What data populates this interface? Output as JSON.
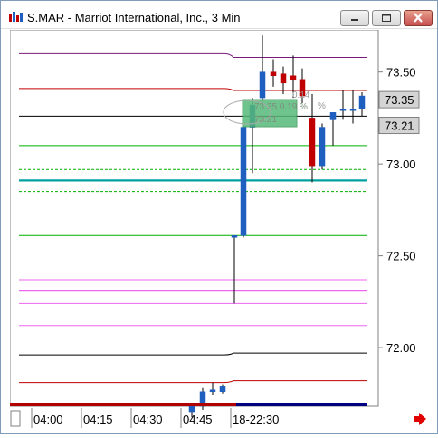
{
  "window": {
    "title": "S.MAR - Marriot International, Inc., 3 Min",
    "buttons": [
      "minimize",
      "maximize",
      "close"
    ]
  },
  "colors": {
    "up_candle": "#1f5fbf",
    "down_candle": "#c00000",
    "purple_line": "#7a1a7a",
    "red_line": "#c00000",
    "black_line": "#000000",
    "green_line": "#00b000",
    "teal_line": "#00a0a0",
    "pink_line": "#ee66ee",
    "bottom_bar_red": "#b00000",
    "bottom_bar_blue": "#000080",
    "price_tag_bg": "#d4d4d4",
    "highlight_box": "#56b97a"
  },
  "chart_data": {
    "type": "candlestick",
    "y_ticks": [
      "73.50",
      "73.00",
      "72.50",
      "72.00"
    ],
    "ylim": [
      71.68,
      73.73
    ],
    "x_ticks": [
      "04:00",
      "04:15",
      "04:30",
      "04:45",
      "18-22:30"
    ],
    "price_tags": [
      {
        "label": "73.35",
        "value": 73.35
      },
      {
        "label": "73.21",
        "value": 73.21
      }
    ],
    "overlay_text": {
      "box_line1": "73.35 0.19 %",
      "box_line2": "73.21",
      "pct_label": "0.14",
      "pct_line2": "%"
    },
    "horizontal_levels": [
      {
        "value": 73.6,
        "value_after": 73.58,
        "color_key": "purple_line",
        "style": "solid"
      },
      {
        "value": 73.41,
        "value_after": 73.4,
        "color_key": "red_line",
        "style": "solid"
      },
      {
        "value": 73.26,
        "value_after": 73.26,
        "color_key": "black_line",
        "style": "solid"
      },
      {
        "value": 73.1,
        "value_after": 73.1,
        "color_key": "green_line",
        "style": "solid"
      },
      {
        "value": 72.97,
        "value_after": 72.97,
        "color_key": "green_line",
        "style": "dashed"
      },
      {
        "value": 72.91,
        "value_after": 72.91,
        "color_key": "teal_line",
        "style": "thick"
      },
      {
        "value": 72.85,
        "value_after": 72.85,
        "color_key": "green_line",
        "style": "dashed"
      },
      {
        "value": 72.61,
        "value_after": 72.61,
        "color_key": "green_line",
        "style": "solid"
      },
      {
        "value": 72.37,
        "value_after": 72.37,
        "color_key": "pink_line",
        "style": "solid"
      },
      {
        "value": 72.31,
        "value_after": 72.31,
        "color_key": "pink_line",
        "style": "thick"
      },
      {
        "value": 72.24,
        "value_after": 72.24,
        "color_key": "pink_line",
        "style": "solid"
      },
      {
        "value": 72.12,
        "value_after": 72.12,
        "color_key": "pink_line",
        "style": "solid"
      },
      {
        "value": 71.96,
        "value_after": 71.97,
        "color_key": "black_line",
        "style": "solid"
      },
      {
        "value": 71.81,
        "value_after": 71.82,
        "color_key": "red_line",
        "style": "solid"
      }
    ],
    "candles": [
      {
        "o": 71.65,
        "h": 71.7,
        "l": 71.62,
        "c": 71.68,
        "dir": "up"
      },
      {
        "o": 71.68,
        "h": 71.78,
        "l": 71.66,
        "c": 71.76,
        "dir": "up"
      },
      {
        "o": 71.76,
        "h": 71.81,
        "l": 71.74,
        "c": 71.77,
        "dir": "up"
      },
      {
        "o": 71.76,
        "h": 71.8,
        "l": 71.75,
        "c": 71.79,
        "dir": "up"
      },
      {
        "o": 72.6,
        "h": 72.61,
        "l": 72.24,
        "c": 72.61,
        "dir": "up"
      },
      {
        "o": 72.61,
        "h": 73.21,
        "l": 72.6,
        "c": 73.2,
        "dir": "up"
      },
      {
        "o": 73.2,
        "h": 73.36,
        "l": 72.95,
        "c": 73.32,
        "dir": "up"
      },
      {
        "o": 73.36,
        "h": 73.7,
        "l": 73.34,
        "c": 73.5,
        "dir": "up"
      },
      {
        "o": 73.5,
        "h": 73.57,
        "l": 73.42,
        "c": 73.48,
        "dir": "down"
      },
      {
        "o": 73.49,
        "h": 73.53,
        "l": 73.38,
        "c": 73.44,
        "dir": "down"
      },
      {
        "o": 73.48,
        "h": 73.59,
        "l": 73.36,
        "c": 73.46,
        "dir": "down"
      },
      {
        "o": 73.46,
        "h": 73.52,
        "l": 73.33,
        "c": 73.37,
        "dir": "down"
      },
      {
        "o": 73.25,
        "h": 73.38,
        "l": 72.9,
        "c": 72.99,
        "dir": "down"
      },
      {
        "o": 72.99,
        "h": 73.22,
        "l": 72.97,
        "c": 73.2,
        "dir": "up"
      },
      {
        "o": 73.24,
        "h": 73.28,
        "l": 73.1,
        "c": 73.28,
        "dir": "up"
      },
      {
        "o": 73.3,
        "h": 73.4,
        "l": 73.24,
        "c": 73.3,
        "dir": "up"
      },
      {
        "o": 73.3,
        "h": 73.4,
        "l": 73.22,
        "c": 73.3,
        "dir": "up"
      },
      {
        "o": 73.3,
        "h": 73.39,
        "l": 73.26,
        "c": 73.37,
        "dir": "up"
      }
    ]
  }
}
